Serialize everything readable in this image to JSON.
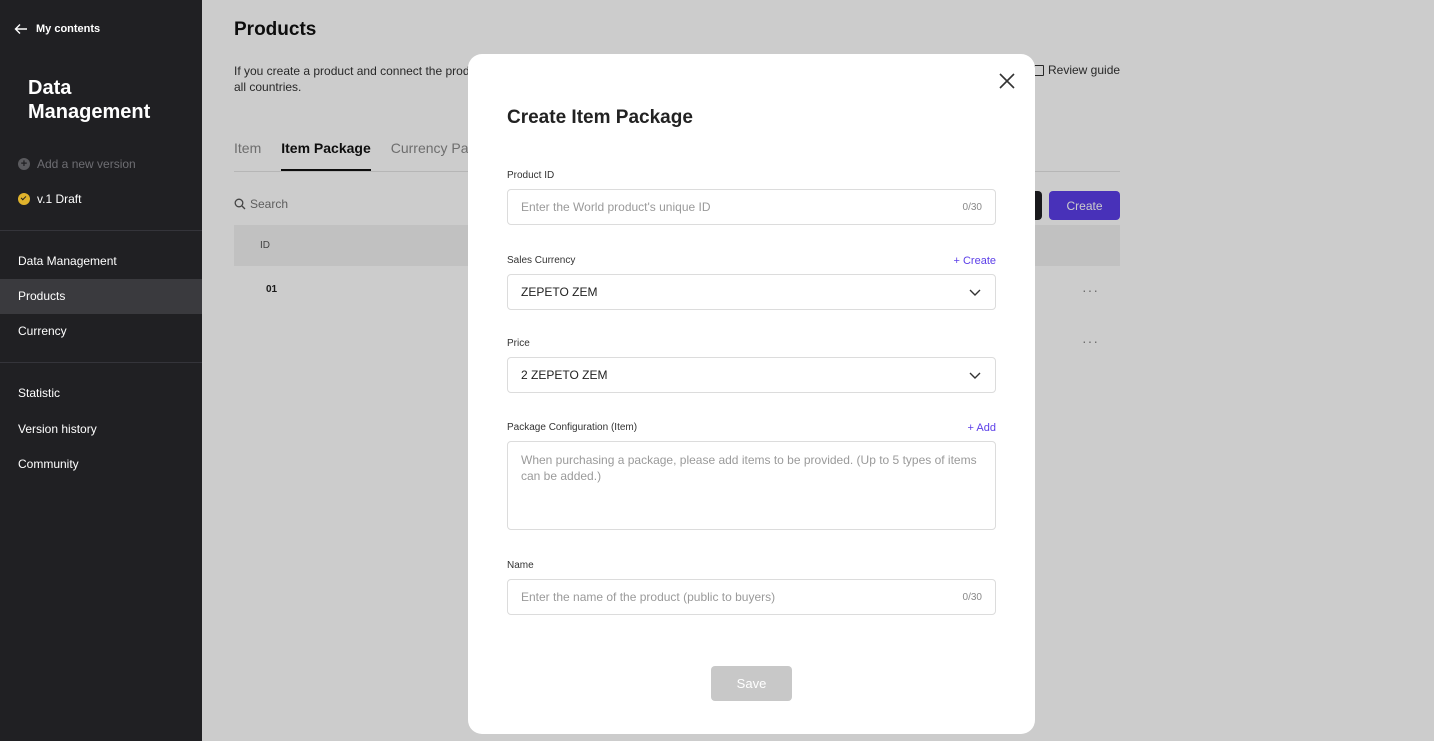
{
  "sidebar": {
    "back_label": "My contents",
    "title": "Data Management",
    "add_version": "Add a new version",
    "version": "v.1 Draft",
    "nav": [
      {
        "label": "Data Management"
      },
      {
        "label": "Products"
      },
      {
        "label": "Currency"
      },
      {
        "label": "Statistic"
      },
      {
        "label": "Version history"
      },
      {
        "label": "Community"
      }
    ]
  },
  "main": {
    "title": "Products",
    "description": "If you create a product and connect the prod be displayed the same in all countries.",
    "review_guide": "Review guide",
    "tabs": [
      {
        "label": "Item"
      },
      {
        "label": "Item Package"
      },
      {
        "label": "Currency Pac"
      }
    ],
    "search_placeholder": "Search",
    "create_label": "Create",
    "table": {
      "header_id": "ID",
      "rows": [
        {
          "id": "01"
        }
      ]
    },
    "more_glyph": "···"
  },
  "modal": {
    "title": "Create Item Package",
    "product_id": {
      "label": "Product ID",
      "placeholder": "Enter the World product's unique ID",
      "count": "0/30"
    },
    "sales_currency": {
      "label": "Sales Currency",
      "link": "+ Create",
      "value": "ZEPETO ZEM"
    },
    "price": {
      "label": "Price",
      "value": "2 ZEPETO ZEM"
    },
    "package_config": {
      "label": "Package Configuration (Item)",
      "link": "+ Add",
      "placeholder": "When purchasing a package, please add items to be provided. (Up to 5 types of items can be added.)"
    },
    "name": {
      "label": "Name",
      "placeholder": "Enter the name of the product (public to buyers)",
      "count": "0/30"
    },
    "save_label": "Save"
  },
  "colors": {
    "accent": "#5b3ee8",
    "sidebar_bg": "#202023",
    "draft_badge": "#e0b32c"
  }
}
